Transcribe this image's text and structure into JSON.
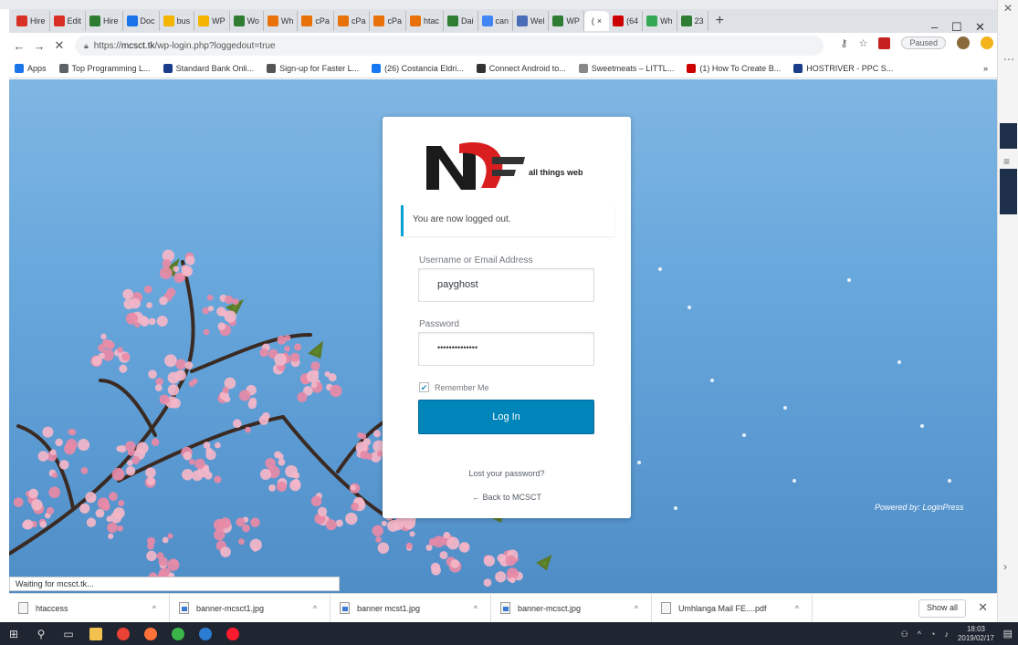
{
  "browser": {
    "tabs": [
      {
        "label": "Hire",
        "color": "#d93025"
      },
      {
        "label": "Edit",
        "color": "#d93025"
      },
      {
        "label": "Hire",
        "color": "#2e7d32"
      },
      {
        "label": "Doc",
        "color": "#1a73e8"
      },
      {
        "label": "bus",
        "color": "#f4b400"
      },
      {
        "label": "WP",
        "color": "#f4b400"
      },
      {
        "label": "Wo",
        "color": "#2e7d32"
      },
      {
        "label": "Wh",
        "color": "#e8710a"
      },
      {
        "label": "cPa",
        "color": "#e8710a"
      },
      {
        "label": "cPa",
        "color": "#e8710a"
      },
      {
        "label": "cPa",
        "color": "#e8710a"
      },
      {
        "label": "htac",
        "color": "#e8710a"
      },
      {
        "label": "Dai",
        "color": "#2e7d32"
      },
      {
        "label": "can",
        "color": "#4285f4"
      },
      {
        "label": "Wel",
        "color": "#4b6cb7"
      },
      {
        "label": "WP",
        "color": "#2e7d32"
      }
    ],
    "active_tab": {
      "label": "(",
      "close": "×"
    },
    "tabs_after": [
      {
        "label": "(64",
        "color": "#cc0000"
      },
      {
        "label": "Wh",
        "color": "#34a853"
      },
      {
        "label": "23",
        "color": "#2e7d32"
      }
    ],
    "new_tab": "+",
    "window_controls": {
      "minimize": "–",
      "maximize": "☐",
      "close": "✕"
    },
    "address": {
      "prefix": "https://",
      "host": "mcsct.tk",
      "path": "/wp-login.php?loggedout=true"
    },
    "nav": {
      "back": "←",
      "forward": "→",
      "stop": "✕"
    },
    "paused_label": "Paused",
    "menu_dots": "⋮",
    "bookmarks": [
      {
        "label": "Apps",
        "color": "#1a73e8"
      },
      {
        "label": "Top Programming L...",
        "color": "#5f6368"
      },
      {
        "label": "Standard Bank Onli...",
        "color": "#1a3c8a"
      },
      {
        "label": "Sign-up for Faster L...",
        "color": "#555"
      },
      {
        "label": "(26) Costancia Eldri...",
        "color": "#1877f2"
      },
      {
        "label": "Connect Android to...",
        "color": "#333"
      },
      {
        "label": "Sweetmeats – LITTL...",
        "color": "#888"
      },
      {
        "label": "(1) How To Create B...",
        "color": "#cc0000"
      },
      {
        "label": "HOSTRIVER - PPC S...",
        "color": "#1a3c8a"
      }
    ],
    "bookmarks_more": "»"
  },
  "login": {
    "logo_text": "all things web",
    "message": "You are now logged out.",
    "username_label": "Username or Email Address",
    "username_value": "payghost",
    "password_label": "Password",
    "password_value": "••••••••••••••",
    "remember_label": "Remember Me",
    "remember_checked": "✔",
    "button_label": "Log In",
    "lost_password": "Lost your password?",
    "back_link": "← Back to MCSCT",
    "powered_by": "Powered by: LoginPress"
  },
  "status": "Waiting for mcsct.tk...",
  "downloads": {
    "items": [
      {
        "name": "htaccess",
        "icon": "file-icon"
      },
      {
        "name": "banner-mcsct1.jpg",
        "icon": "image-icon"
      },
      {
        "name": "banner mcst1.jpg",
        "icon": "image-icon"
      },
      {
        "name": "banner-mcsct.jpg",
        "icon": "image-icon"
      },
      {
        "name": "Umhlanga Mail FE....pdf",
        "icon": "pdf-icon"
      }
    ],
    "caret": "^",
    "show_all": "Show all",
    "close": "✕"
  },
  "taskbar": {
    "clock_time": "18:03",
    "clock_date": "2019/02/17",
    "tray": "^"
  },
  "colors": {
    "button": "#0085ba",
    "message_border": "#00a0d2",
    "taskbar": "#1f2531"
  }
}
